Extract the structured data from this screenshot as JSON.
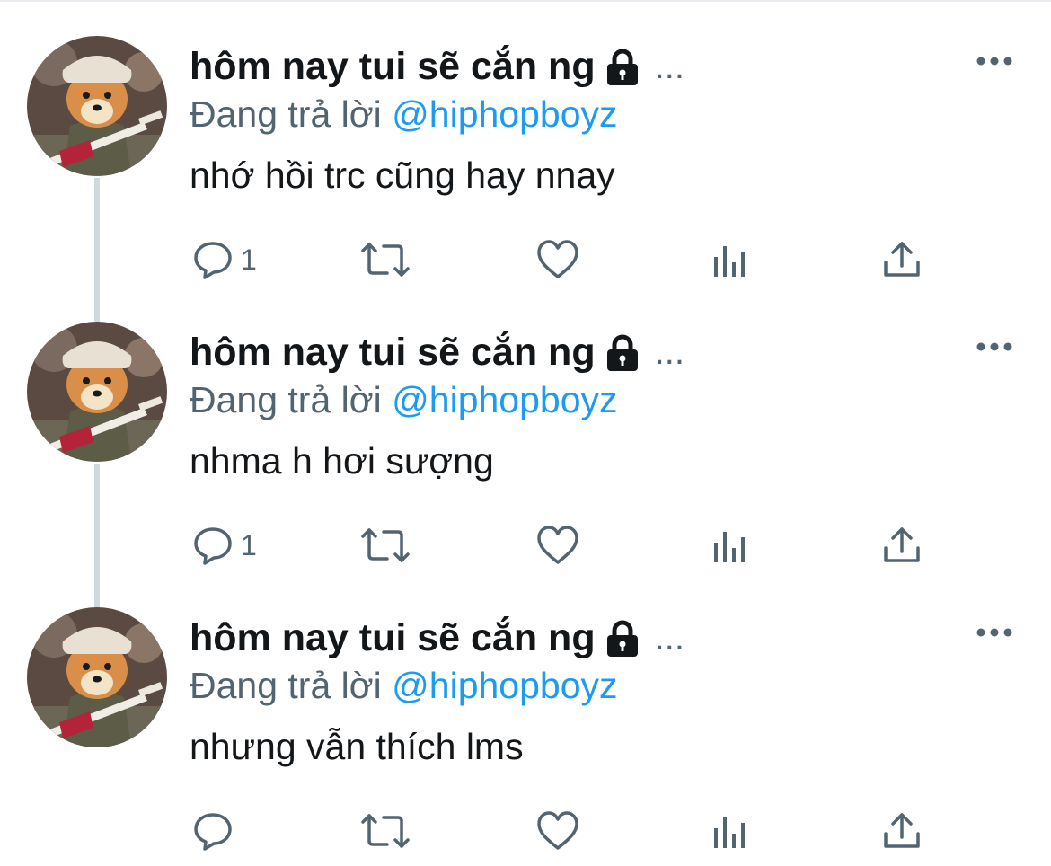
{
  "colors": {
    "accent": "#1d9bf0",
    "secondary_text": "#536471",
    "primary_text": "#14171a",
    "thread_line": "#cfd9de"
  },
  "tweets": [
    {
      "display_name": "hôm nay tui sẽ cắn ng",
      "name_truncation": "...",
      "replying_prefix": "Đang trả lời",
      "replying_handle": "@hiphopboyz",
      "text": "nhớ hồi trc cũng hay nnay",
      "reply_count": "1",
      "icons": [
        "lock-icon",
        "more-icon",
        "reply-icon",
        "retweet-icon",
        "like-icon",
        "views-icon",
        "share-icon"
      ]
    },
    {
      "display_name": "hôm nay tui sẽ cắn ng",
      "name_truncation": "...",
      "replying_prefix": "Đang trả lời",
      "replying_handle": "@hiphopboyz",
      "text": "nhma h hơi sượng",
      "reply_count": "1",
      "icons": [
        "lock-icon",
        "more-icon",
        "reply-icon",
        "retweet-icon",
        "like-icon",
        "views-icon",
        "share-icon"
      ]
    },
    {
      "display_name": "hôm nay tui sẽ cắn ng",
      "name_truncation": "...",
      "replying_prefix": "Đang trả lời",
      "replying_handle": "@hiphopboyz",
      "text": "nhưng vẫn thích lms",
      "reply_count": "",
      "icons": [
        "lock-icon",
        "more-icon",
        "reply-icon",
        "retweet-icon",
        "like-icon",
        "views-icon",
        "share-icon"
      ]
    }
  ]
}
